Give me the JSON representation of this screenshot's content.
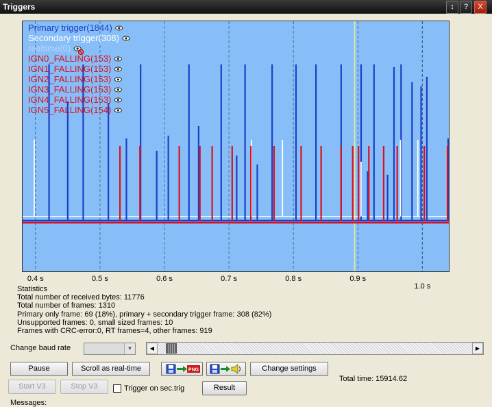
{
  "window": {
    "title": "Triggers",
    "buttons": [
      "↕",
      "?",
      "X"
    ]
  },
  "chart_data": {
    "type": "line",
    "x_ticks": [
      "0.4 s",
      "0.5 s",
      "0.6 s",
      "0.7 s",
      "0.8 s",
      "0.9 s",
      "1.0 s"
    ],
    "x_tick_values": [
      0.4,
      0.5,
      0.6,
      0.7,
      0.8,
      0.9,
      1.0
    ],
    "xlim": [
      0.38,
      1.04
    ],
    "cursor_x": 0.895,
    "legend_position": "top-left",
    "series": [
      {
        "name": "Primary trigger(1844)",
        "color": "#1c3fc9",
        "x": [
          0.421,
          0.45,
          0.474,
          0.513,
          0.541,
          0.563,
          0.588,
          0.606,
          0.638,
          0.653,
          0.688,
          0.712,
          0.725,
          0.744,
          0.767,
          0.804,
          0.835,
          0.874,
          0.905,
          0.915,
          0.925,
          0.946,
          0.956,
          0.967,
          0.984,
          0.998,
          1.007,
          1.04
        ]
      },
      {
        "name": "Secondary trigger(308)",
        "color": "#ffffff",
        "x": [
          0.398,
          0.735,
          0.783,
          0.905,
          0.966,
          0.993
        ]
      },
      {
        "name": "realtime(0)",
        "color": "#b8d8f8",
        "x": []
      },
      {
        "name": "IGN0_FALLING(153)",
        "color": "#dd0f1e",
        "x": [
          0.531,
          0.674,
          0.843
        ]
      },
      {
        "name": "IGN1_FALLING(153)",
        "color": "#dd0f1e",
        "x": [
          0.562,
          0.705,
          0.874
        ]
      },
      {
        "name": "IGN2_FALLING(153)",
        "color": "#dd0f1e",
        "x": [
          0.655,
          0.812,
          0.94
        ]
      },
      {
        "name": "IGN3_FALLING(153)",
        "color": "#dd0f1e",
        "x": [
          0.623,
          0.77,
          0.917
        ]
      },
      {
        "name": "IGN4_FALLING(153)",
        "color": "#dd0f1e",
        "x": [
          0.734,
          0.892,
          1.003
        ]
      },
      {
        "name": "IGN5_FALLING(154)",
        "color": "#dd0f1e",
        "x": [
          0.901,
          0.961,
          1.039
        ]
      }
    ]
  },
  "stats": {
    "heading": "Statistics",
    "lines": [
      "Total number of received bytes: 11776",
      "Total number of frames: 1310",
      "Primary only frame: 69 (18%), primary + secondary trigger frame: 308 (82%)",
      "Unsupported frames: 0, small sized frames: 10",
      "Frames with CRC-error:0, RT frames=4, other frames: 919"
    ]
  },
  "baud": {
    "label": "Change baud rate",
    "value": ""
  },
  "buttons": {
    "pause": "Pause",
    "scroll_realtime": "Scroll as real-time",
    "change_settings": "Change settings",
    "start_v3": "Start V3",
    "stop_v3": "Stop V3",
    "result": "Result"
  },
  "icons": {
    "save_png": "save-to-png-icon",
    "save_sound": "save-to-sound-icon"
  },
  "png_badge": "PNG",
  "trigger_sec_label": "Trigger on sec.trig",
  "total_time": "Total time: 15914.62",
  "messages_label": "Messages:",
  "colors": {
    "plot_bg": "#87bef7",
    "primary": "#1c3fc9",
    "secondary": "#ffffff",
    "ign": "#dd0f1e",
    "cursor": "#d8e8a8"
  }
}
